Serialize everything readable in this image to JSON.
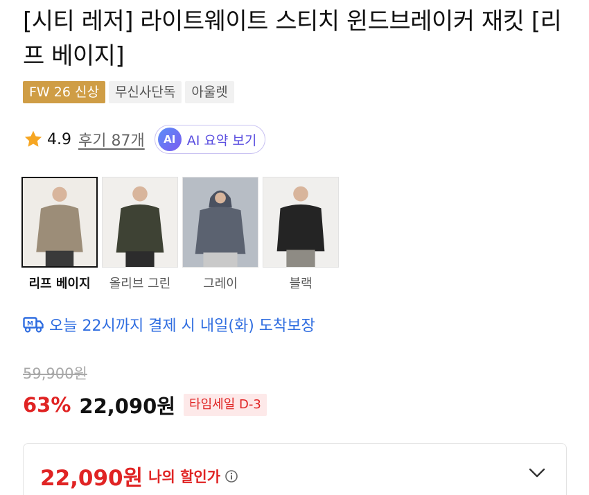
{
  "product": {
    "title": "[시티 레저] 라이트웨이트 스티치 윈드브레이커 재킷 [리프 베이지]",
    "tags": [
      {
        "label": "FW 26 신상",
        "type": "new"
      },
      {
        "label": "무신사단독",
        "type": "normal"
      },
      {
        "label": "아울렛",
        "type": "normal"
      }
    ],
    "rating": "4.9",
    "review_link": "후기 87개",
    "ai_badge": "AI",
    "ai_label": "AI 요약 보기"
  },
  "colors": [
    {
      "name": "리프 베이지",
      "selected": true,
      "swatch": "#9c8d78"
    },
    {
      "name": "올리브 그린",
      "selected": false,
      "swatch": "#3e4234"
    },
    {
      "name": "그레이",
      "selected": false,
      "swatch": "#5b6270"
    },
    {
      "name": "블랙",
      "selected": false,
      "swatch": "#242424"
    }
  ],
  "delivery": {
    "icon": "delivery-truck-icon",
    "text": "오늘 22시까지 결제 시 내일(화) 도착보장",
    "color": "#2f6de0"
  },
  "pricing": {
    "original": "59,900원",
    "discount": "63%",
    "sale": "22,090원",
    "timesale_badge": "타임세일 D-3",
    "accent": "#e02424"
  },
  "my_discount": {
    "price": "22,090원",
    "label": "나의 할인가",
    "info_icon": "info-icon",
    "expand_icon": "chevron-down-icon"
  }
}
